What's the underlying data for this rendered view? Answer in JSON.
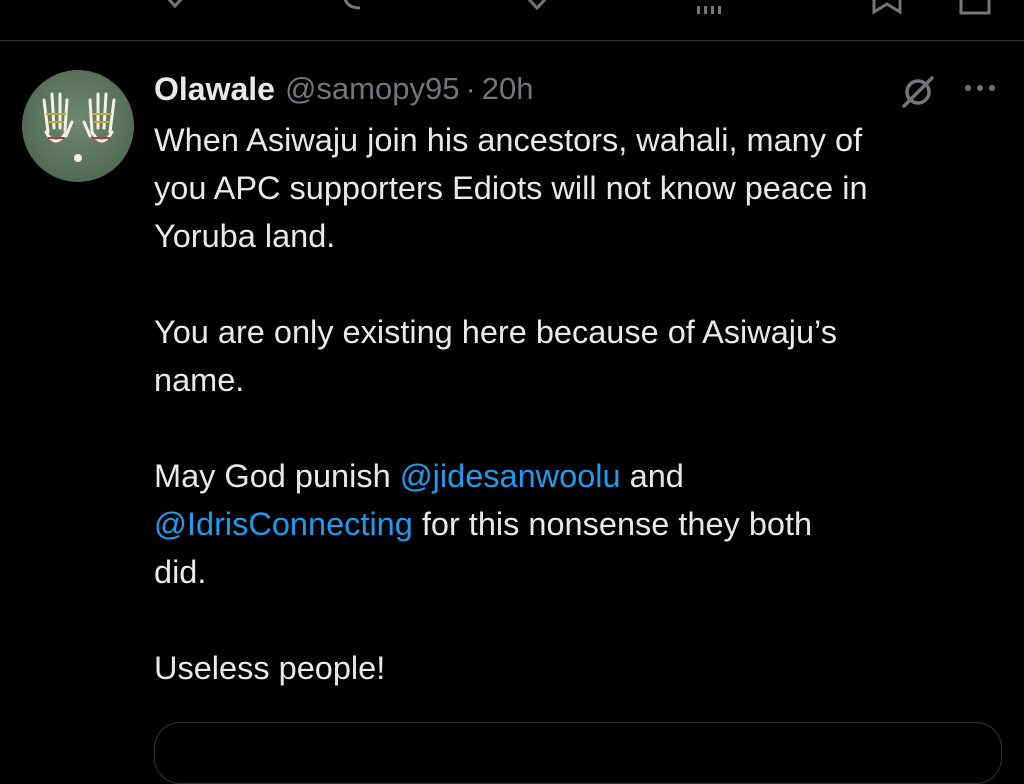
{
  "top_actions": {
    "icons": [
      "reply-icon",
      "repost-icon",
      "like-icon",
      "views-icon",
      "bookmark-icon",
      "share-icon"
    ]
  },
  "tweet": {
    "author_name": "Olawale",
    "handle": "@samopy95",
    "separator": "·",
    "time": "20h",
    "body": {
      "line1": "When Asiwaju join his ancestors, wahali, many of",
      "line2": "you APC supporters Ediots will not know peace in",
      "line3": "Yoruba land.",
      "para2_line1": "You are only existing here because of Asiwaju’s",
      "para2_line2": "name.",
      "para3_part1": "May God punish ",
      "mention1": "@jidesanwoolu",
      "para3_part2": " and",
      "mention2": "@IdrisConnecting",
      "para3_part3": " for this nonsense they both",
      "para3_part4": "did.",
      "para4": "Useless people!"
    }
  },
  "colors": {
    "background": "#000000",
    "text": "#e7e9ea",
    "secondary": "#71767b",
    "mention": "#1d9bf0",
    "border": "#2f3336"
  }
}
